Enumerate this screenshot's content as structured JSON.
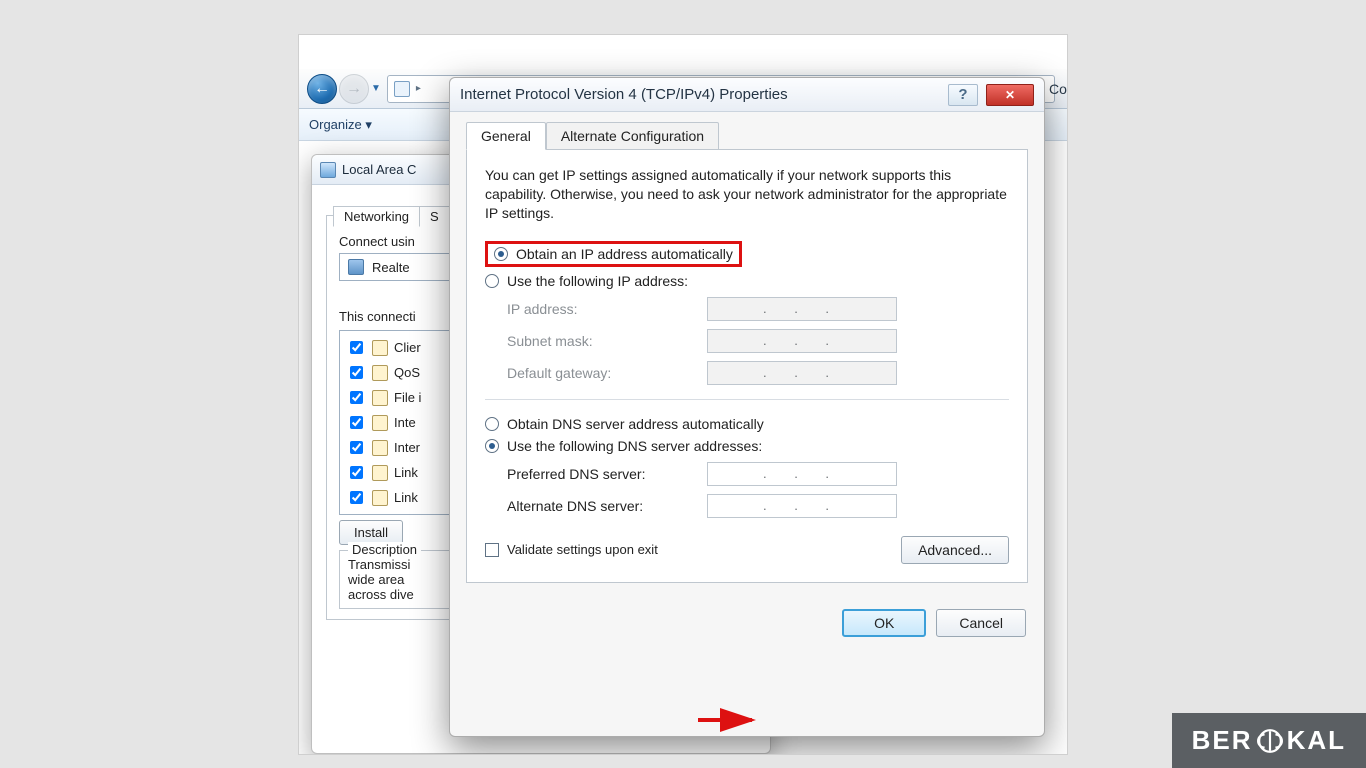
{
  "explorer": {
    "organize": "Organize ▾"
  },
  "partial": {
    "conn": "Conn"
  },
  "lac": {
    "title": "Local Area C",
    "tab_networking": "Networking",
    "tab_s": "S",
    "connect_using_label": "Connect usin",
    "adapter": "Realte",
    "conn_uses_label": "This connecti",
    "items": [
      "Clier",
      "QoS",
      "File i",
      "Inte",
      "Inter",
      "Link",
      "Link"
    ],
    "install": "Install ",
    "description_label": "Description",
    "desc1": "Transmissi",
    "desc2": "wide area",
    "desc3": "across dive"
  },
  "ipv4": {
    "title": "Internet Protocol Version 4 (TCP/IPv4) Properties",
    "help_symbol": "?",
    "close_symbol": "✕",
    "tab_general": "General",
    "tab_alt": "Alternate Configuration",
    "infotext": "You can get IP settings assigned automatically if your network supports this capability. Otherwise, you need to ask your network administrator for the appropriate IP settings.",
    "opt_auto_ip": "Obtain an IP address automatically",
    "opt_manual_ip": "Use the following IP address:",
    "lbl_ip": "IP address:",
    "lbl_subnet": "Subnet mask:",
    "lbl_gateway": "Default gateway:",
    "opt_auto_dns": "Obtain DNS server address automatically",
    "opt_manual_dns": "Use the following DNS server addresses:",
    "lbl_pref_dns": "Preferred DNS server:",
    "lbl_alt_dns": "Alternate DNS server:",
    "ip_dots": ".   .   .",
    "validate": "Validate settings upon exit",
    "advanced": "Advanced...",
    "ok": "OK",
    "cancel": "Cancel"
  },
  "watermark": {
    "pre": "BER",
    "post": "KAL"
  }
}
